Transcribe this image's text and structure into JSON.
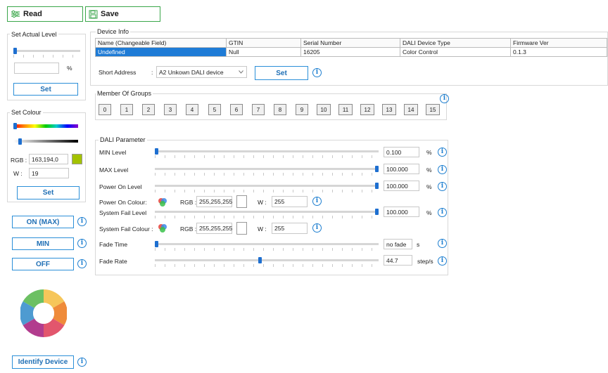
{
  "toolbar": {
    "read_label": "Read",
    "save_label": "Save"
  },
  "left": {
    "actual_level": {
      "title": "Set Actual Level",
      "value": "",
      "unit": "%",
      "level": 0.0,
      "set_label": "Set"
    },
    "colour": {
      "title": "Set Colour",
      "rgb_label": "RGB :",
      "rgb_value": "163,194,0",
      "w_label": "W :",
      "w_value": "19",
      "swatch": "#a3c200",
      "set_label": "Set"
    },
    "on_label": "ON (MAX)",
    "min_label": "MIN",
    "off_label": "OFF",
    "identify_label": "Identify Device"
  },
  "device_info": {
    "title": "Device Info",
    "columns": [
      "Name (Changeable Field)",
      "GTIN",
      "Serial Number",
      "DALI Device Type",
      "Firmware Ver"
    ],
    "row": [
      "Undefined",
      "Null",
      "16205",
      "Color Control",
      "0.1.3"
    ],
    "short_address_label": "Short Address",
    "short_address_colon": ":",
    "short_address_value": "A2 Unkown DALI device",
    "set_label": "Set"
  },
  "groups": {
    "title": "Member Of Groups",
    "items": [
      "0",
      "1",
      "2",
      "3",
      "4",
      "5",
      "6",
      "7",
      "8",
      "9",
      "10",
      "11",
      "12",
      "13",
      "14",
      "15"
    ]
  },
  "dali": {
    "title": "DALI Parameter",
    "min_level": {
      "label": "MIN Level",
      "value": "0.100",
      "unit": "%",
      "level": 0.001
    },
    "max_level": {
      "label": "MAX Level",
      "value": "100.000",
      "unit": "%",
      "level": 1.0
    },
    "power_on_level": {
      "label": "Power On Level",
      "value": "100.000",
      "unit": "%",
      "level": 1.0
    },
    "power_on_colour": {
      "label": "Power On Colour:",
      "rgb_label": "RGB :",
      "rgb_value": "255,255,255",
      "w_label": "W :",
      "w_value": "255",
      "swatch": "#ffffff"
    },
    "system_fail_level": {
      "label": "System Fail Level",
      "value": "100.000",
      "unit": "%",
      "level": 1.0
    },
    "system_fail_colour": {
      "label": "System Fail  Colour :",
      "rgb_label": "RGB :",
      "rgb_value": "255,255,255",
      "w_label": "W :",
      "w_value": "255",
      "swatch": "#ffffff"
    },
    "fade_time": {
      "label": "Fade Time",
      "value": "no fade",
      "unit": "s",
      "level": 0.0
    },
    "fade_rate": {
      "label": "Fade Rate",
      "value": "44.7",
      "unit": "step/s",
      "level": 0.47
    }
  },
  "colors": {
    "accent": "#1e7fd0",
    "toolbar_border": "#3aa64a",
    "selection": "#1e7bd6"
  },
  "icons": {
    "read": "read-sliders-icon",
    "save": "save-disk-icon",
    "info": "info-icon",
    "rgb": "rgb-circles-icon",
    "wheel": "colour-wheel-icon"
  }
}
